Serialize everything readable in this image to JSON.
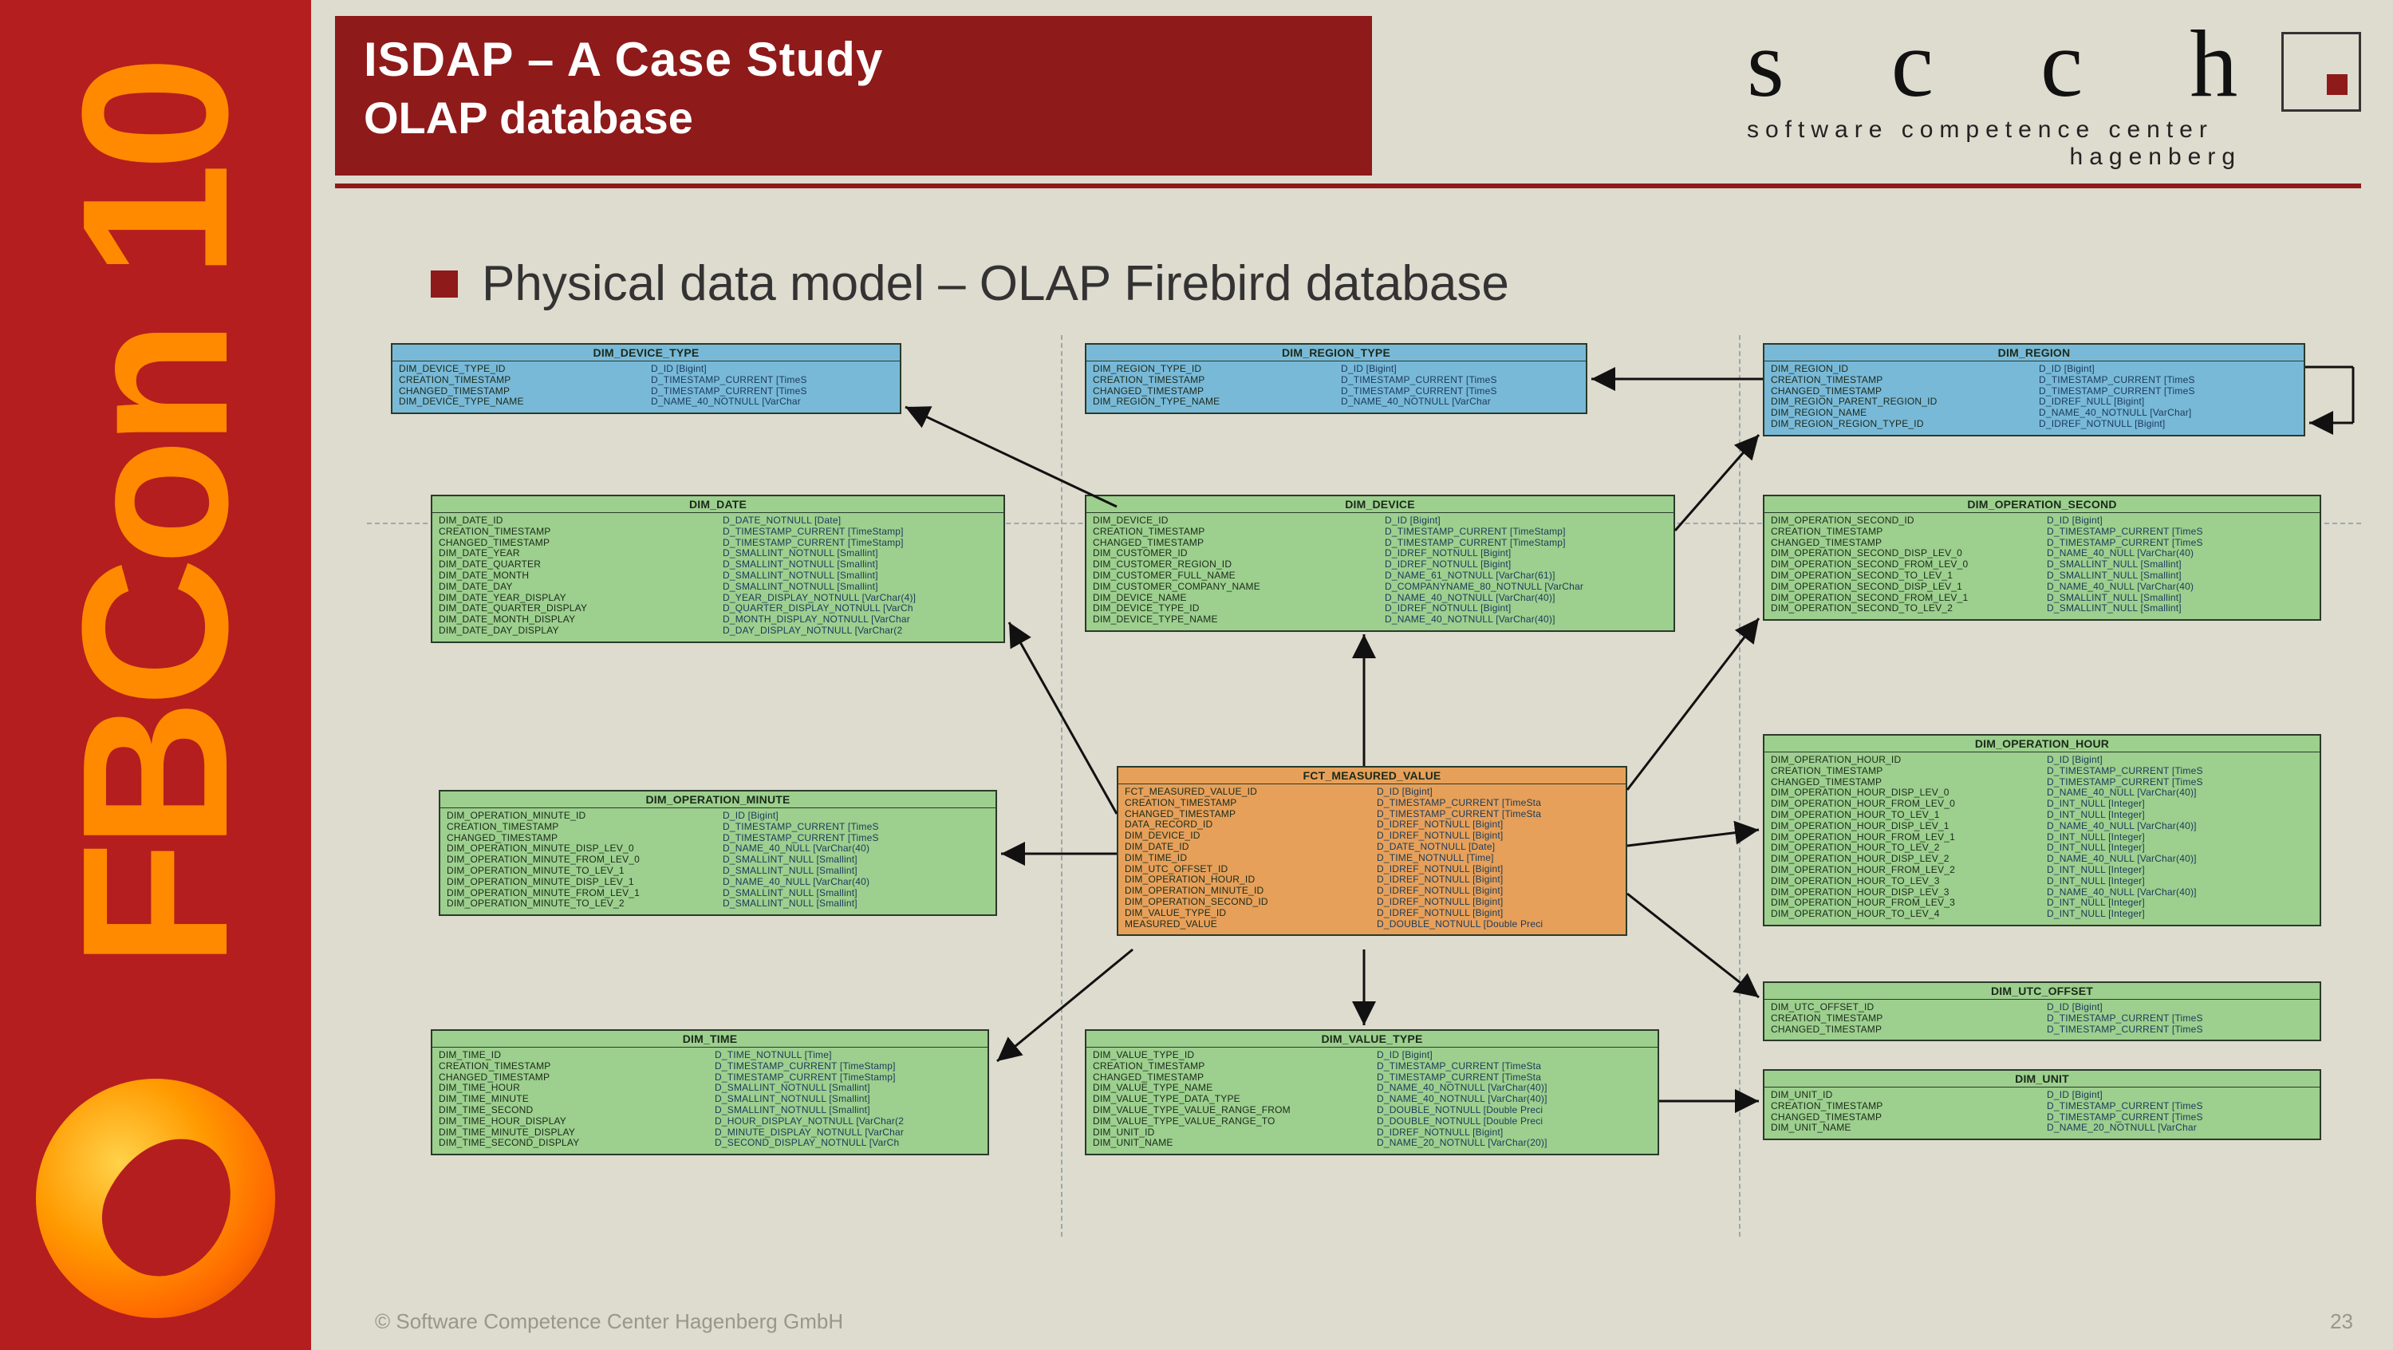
{
  "sidebar": {
    "brand": "FBCon 10"
  },
  "header": {
    "title": "ISDAP – A Case Study",
    "subtitle": "OLAP database"
  },
  "scch": {
    "logo": "s c c h",
    "line1": "software competence center",
    "line2": "hagenberg"
  },
  "section_heading": "Physical data model – OLAP Firebird database",
  "footer": {
    "copyright": "© Software Competence Center Hagenberg GmbH",
    "page": "23"
  },
  "entities": {
    "dim_device_type": {
      "title": "DIM_DEVICE_TYPE",
      "left": "DIM_DEVICE_TYPE_ID\nCREATION_TIMESTAMP\nCHANGED_TIMESTAMP\nDIM_DEVICE_TYPE_NAME",
      "right": "D_ID [Bigint]\nD_TIMESTAMP_CURRENT [TimeS\nD_TIMESTAMP_CURRENT [TimeS\nD_NAME_40_NOTNULL [VarChar"
    },
    "dim_region_type": {
      "title": "DIM_REGION_TYPE",
      "left": "DIM_REGION_TYPE_ID\nCREATION_TIMESTAMP\nCHANGED_TIMESTAMP\nDIM_REGION_TYPE_NAME",
      "right": "D_ID [Bigint]\nD_TIMESTAMP_CURRENT [TimeS\nD_TIMESTAMP_CURRENT [TimeS\nD_NAME_40_NOTNULL [VarChar"
    },
    "dim_region": {
      "title": "DIM_REGION",
      "left": "DIM_REGION_ID\nCREATION_TIMESTAMP\nCHANGED_TIMESTAMP\nDIM_REGION_PARENT_REGION_ID\nDIM_REGION_NAME\nDIM_REGION_REGION_TYPE_ID",
      "right": "D_ID [Bigint]\nD_TIMESTAMP_CURRENT [TimeS\nD_TIMESTAMP_CURRENT [TimeS\nD_IDREF_NULL [Bigint]\nD_NAME_40_NOTNULL [VarChar]\nD_IDREF_NOTNULL [Bigint]"
    },
    "dim_date": {
      "title": "DIM_DATE",
      "left": "DIM_DATE_ID\nCREATION_TIMESTAMP\nCHANGED_TIMESTAMP\nDIM_DATE_YEAR\nDIM_DATE_QUARTER\nDIM_DATE_MONTH\nDIM_DATE_DAY\nDIM_DATE_YEAR_DISPLAY\nDIM_DATE_QUARTER_DISPLAY\nDIM_DATE_MONTH_DISPLAY\nDIM_DATE_DAY_DISPLAY",
      "right": "D_DATE_NOTNULL [Date]\nD_TIMESTAMP_CURRENT [TimeStamp]\nD_TIMESTAMP_CURRENT [TimeStamp]\nD_SMALLINT_NOTNULL [Smallint]\nD_SMALLINT_NOTNULL [Smallint]\nD_SMALLINT_NOTNULL [Smallint]\nD_SMALLINT_NOTNULL [Smallint]\nD_YEAR_DISPLAY_NOTNULL [VarChar(4)]\nD_QUARTER_DISPLAY_NOTNULL [VarCh\nD_MONTH_DISPLAY_NOTNULL [VarChar\nD_DAY_DISPLAY_NOTNULL [VarChar(2"
    },
    "dim_device": {
      "title": "DIM_DEVICE",
      "left": "DIM_DEVICE_ID\nCREATION_TIMESTAMP\nCHANGED_TIMESTAMP\nDIM_CUSTOMER_ID\nDIM_CUSTOMER_REGION_ID\nDIM_CUSTOMER_FULL_NAME\nDIM_CUSTOMER_COMPANY_NAME\nDIM_DEVICE_NAME\nDIM_DEVICE_TYPE_ID\nDIM_DEVICE_TYPE_NAME",
      "right": "D_ID [Bigint]\nD_TIMESTAMP_CURRENT [TimeStamp]\nD_TIMESTAMP_CURRENT [TimeStamp]\nD_IDREF_NOTNULL [Bigint]\nD_IDREF_NOTNULL [Bigint]\nD_NAME_61_NOTNULL [VarChar(61)]\nD_COMPANYNAME_80_NOTNULL [VarChar\nD_NAME_40_NOTNULL [VarChar(40)]\nD_IDREF_NOTNULL [Bigint]\nD_NAME_40_NOTNULL [VarChar(40)]"
    },
    "dim_operation_second": {
      "title": "DIM_OPERATION_SECOND",
      "left": "DIM_OPERATION_SECOND_ID\nCREATION_TIMESTAMP\nCHANGED_TIMESTAMP\nDIM_OPERATION_SECOND_DISP_LEV_0\nDIM_OPERATION_SECOND_FROM_LEV_0\nDIM_OPERATION_SECOND_TO_LEV_1\nDIM_OPERATION_SECOND_DISP_LEV_1\nDIM_OPERATION_SECOND_FROM_LEV_1\nDIM_OPERATION_SECOND_TO_LEV_2",
      "right": "D_ID [Bigint]\nD_TIMESTAMP_CURRENT [TimeS\nD_TIMESTAMP_CURRENT [TimeS\nD_NAME_40_NULL [VarChar(40)\nD_SMALLINT_NULL [Smallint]\nD_SMALLINT_NULL [Smallint]\nD_NAME_40_NULL [VarChar(40)\nD_SMALLINT_NULL [Smallint]\nD_SMALLINT_NULL [Smallint]"
    },
    "dim_operation_minute": {
      "title": "DIM_OPERATION_MINUTE",
      "left": "DIM_OPERATION_MINUTE_ID\nCREATION_TIMESTAMP\nCHANGED_TIMESTAMP\nDIM_OPERATION_MINUTE_DISP_LEV_0\nDIM_OPERATION_MINUTE_FROM_LEV_0\nDIM_OPERATION_MINUTE_TO_LEV_1\nDIM_OPERATION_MINUTE_DISP_LEV_1\nDIM_OPERATION_MINUTE_FROM_LEV_1\nDIM_OPERATION_MINUTE_TO_LEV_2",
      "right": "D_ID [Bigint]\nD_TIMESTAMP_CURRENT [TimeS\nD_TIMESTAMP_CURRENT [TimeS\nD_NAME_40_NULL [VarChar(40)\nD_SMALLINT_NULL [Smallint]\nD_SMALLINT_NULL [Smallint]\nD_NAME_40_NULL [VarChar(40)\nD_SMALLINT_NULL [Smallint]\nD_SMALLINT_NULL [Smallint]"
    },
    "fct_measured_value": {
      "title": "FCT_MEASURED_VALUE",
      "left": "FCT_MEASURED_VALUE_ID\nCREATION_TIMESTAMP\nCHANGED_TIMESTAMP\nDATA_RECORD_ID\nDIM_DEVICE_ID\nDIM_DATE_ID\nDIM_TIME_ID\nDIM_UTC_OFFSET_ID\nDIM_OPERATION_HOUR_ID\nDIM_OPERATION_MINUTE_ID\nDIM_OPERATION_SECOND_ID\nDIM_VALUE_TYPE_ID\nMEASURED_VALUE",
      "right": "D_ID [Bigint]\nD_TIMESTAMP_CURRENT [TimeSta\nD_TIMESTAMP_CURRENT [TimeSta\nD_IDREF_NOTNULL [Bigint]\nD_IDREF_NOTNULL [Bigint]\nD_DATE_NOTNULL [Date]\nD_TIME_NOTNULL [Time]\nD_IDREF_NOTNULL [Bigint]\nD_IDREF_NOTNULL [Bigint]\nD_IDREF_NOTNULL [Bigint]\nD_IDREF_NOTNULL [Bigint]\nD_IDREF_NOTNULL [Bigint]\nD_DOUBLE_NOTNULL [Double Preci"
    },
    "dim_operation_hour": {
      "title": "DIM_OPERATION_HOUR",
      "left": "DIM_OPERATION_HOUR_ID\nCREATION_TIMESTAMP\nCHANGED_TIMESTAMP\nDIM_OPERATION_HOUR_DISP_LEV_0\nDIM_OPERATION_HOUR_FROM_LEV_0\nDIM_OPERATION_HOUR_TO_LEV_1\nDIM_OPERATION_HOUR_DISP_LEV_1\nDIM_OPERATION_HOUR_FROM_LEV_1\nDIM_OPERATION_HOUR_TO_LEV_2\nDIM_OPERATION_HOUR_DISP_LEV_2\nDIM_OPERATION_HOUR_FROM_LEV_2\nDIM_OPERATION_HOUR_TO_LEV_3\nDIM_OPERATION_HOUR_DISP_LEV_3\nDIM_OPERATION_HOUR_FROM_LEV_3\nDIM_OPERATION_HOUR_TO_LEV_4",
      "right": "D_ID [Bigint]\nD_TIMESTAMP_CURRENT [TimeS\nD_TIMESTAMP_CURRENT [TimeS\nD_NAME_40_NULL [VarChar(40)]\nD_INT_NULL [Integer]\nD_INT_NULL [Integer]\nD_NAME_40_NULL [VarChar(40)]\nD_INT_NULL [Integer]\nD_INT_NULL [Integer]\nD_NAME_40_NULL [VarChar(40)]\nD_INT_NULL [Integer]\nD_INT_NULL [Integer]\nD_NAME_40_NULL [VarChar(40)]\nD_INT_NULL [Integer]\nD_INT_NULL [Integer]"
    },
    "dim_time": {
      "title": "DIM_TIME",
      "left": "DIM_TIME_ID\nCREATION_TIMESTAMP\nCHANGED_TIMESTAMP\nDIM_TIME_HOUR\nDIM_TIME_MINUTE\nDIM_TIME_SECOND\nDIM_TIME_HOUR_DISPLAY\nDIM_TIME_MINUTE_DISPLAY\nDIM_TIME_SECOND_DISPLAY",
      "right": "D_TIME_NOTNULL [Time]\nD_TIMESTAMP_CURRENT [TimeStamp]\nD_TIMESTAMP_CURRENT [TimeStamp]\nD_SMALLINT_NOTNULL [Smallint]\nD_SMALLINT_NOTNULL [Smallint]\nD_SMALLINT_NOTNULL [Smallint]\nD_HOUR_DISPLAY_NOTNULL [VarChar(2\nD_MINUTE_DISPLAY_NOTNULL [VarChar\nD_SECOND_DISPLAY_NOTNULL [VarCh"
    },
    "dim_value_type": {
      "title": "DIM_VALUE_TYPE",
      "left": "DIM_VALUE_TYPE_ID\nCREATION_TIMESTAMP\nCHANGED_TIMESTAMP\nDIM_VALUE_TYPE_NAME\nDIM_VALUE_TYPE_DATA_TYPE\nDIM_VALUE_TYPE_VALUE_RANGE_FROM\nDIM_VALUE_TYPE_VALUE_RANGE_TO\nDIM_UNIT_ID\nDIM_UNIT_NAME",
      "right": "D_ID [Bigint]\nD_TIMESTAMP_CURRENT [TimeSta\nD_TIMESTAMP_CURRENT [TimeSta\nD_NAME_40_NOTNULL [VarChar(40)]\nD_NAME_40_NOTNULL [VarChar(40)]\nD_DOUBLE_NOTNULL [Double Preci\nD_DOUBLE_NOTNULL [Double Preci\nD_IDREF_NOTNULL [Bigint]\nD_NAME_20_NOTNULL [VarChar(20)]"
    },
    "dim_utc_offset": {
      "title": "DIM_UTC_OFFSET",
      "left": "DIM_UTC_OFFSET_ID\nCREATION_TIMESTAMP\nCHANGED_TIMESTAMP",
      "right": "D_ID [Bigint]\nD_TIMESTAMP_CURRENT [TimeS\nD_TIMESTAMP_CURRENT [TimeS"
    },
    "dim_unit": {
      "title": "DIM_UNIT",
      "left": "DIM_UNIT_ID\nCREATION_TIMESTAMP\nCHANGED_TIMESTAMP\nDIM_UNIT_NAME",
      "right": "D_ID [Bigint]\nD_TIMESTAMP_CURRENT [TimeS\nD_TIMESTAMP_CURRENT [TimeS\nD_NAME_20_NOTNULL [VarChar"
    }
  }
}
